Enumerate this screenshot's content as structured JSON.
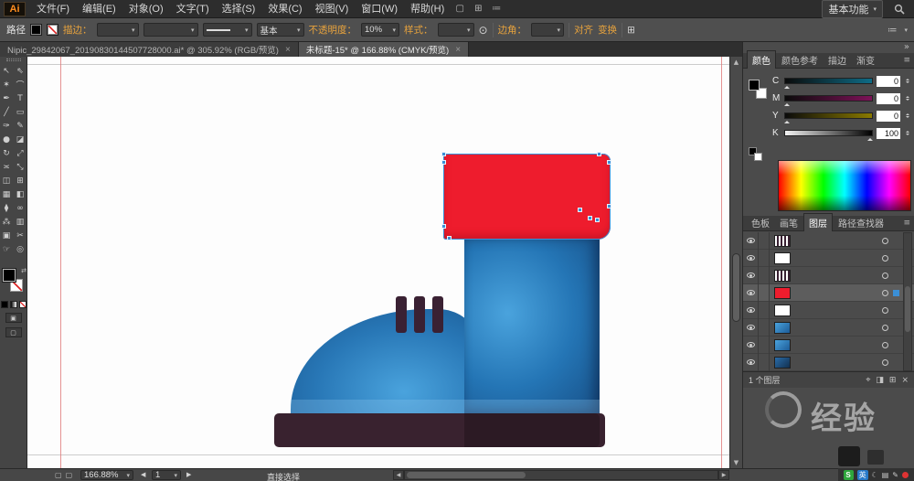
{
  "colors": {
    "red": "#ee1c2d",
    "blue_light": "#4aa3dd",
    "blue_mid": "#2475b5",
    "blue_dark": "#174e85",
    "plum": "#3a2133",
    "base_dark": "#39222f",
    "accent_orange": "#e8a33d",
    "select_blue": "#3b8fd6"
  },
  "icons": {
    "caret_down": "▾",
    "panel_menu": "≡",
    "collapse_right": "»",
    "scroll_up": "▲",
    "scroll_down": "▼",
    "scroll_left": "◀",
    "scroll_right": "▶",
    "doc_new": "▢",
    "grid": "⊞",
    "rows": "≔",
    "recolor": "⊙",
    "swap": "⇄",
    "moon": "☾",
    "pencil": "✎",
    "keyboard": "▤",
    "target_new": "⌖",
    "clip": "◨",
    "new_layer": "⊞",
    "delete": "⨯",
    "draw_mode": "▣",
    "screen_mode": "▢",
    "page_a": "▢",
    "page_b": "▢"
  },
  "menubar": {
    "logo": "Ai",
    "items": [
      {
        "label": "文件(F)"
      },
      {
        "label": "编辑(E)"
      },
      {
        "label": "对象(O)"
      },
      {
        "label": "文字(T)"
      },
      {
        "label": "选择(S)"
      },
      {
        "label": "效果(C)"
      },
      {
        "label": "视图(V)"
      },
      {
        "label": "窗口(W)"
      },
      {
        "label": "帮助(H)"
      }
    ],
    "workspace": "基本功能"
  },
  "controlbar": {
    "path_label": "路径",
    "stroke_label": "描边：",
    "basic_label": "基本",
    "opacity_label": "不透明度：",
    "opacity_value": "10%",
    "style_label": "样式：",
    "corner_label": "边角：",
    "align_label": "对齐",
    "transform_label": "变换"
  },
  "tabs": [
    {
      "title": "Nipic_29842067_20190830144507728000.ai* @ 305.92% (RGB/预览)",
      "close": "×"
    },
    {
      "title": "未标题-15* @ 166.88% (CMYK/预览)",
      "close": "×"
    }
  ],
  "toolbar": {
    "tools": [
      {
        "name": "selection-tool",
        "glyph": "↖"
      },
      {
        "name": "direct-selection-tool",
        "glyph": "⇖"
      },
      {
        "name": "magic-wand-tool",
        "glyph": "✶"
      },
      {
        "name": "lasso-tool",
        "glyph": "⌒"
      },
      {
        "name": "pen-tool",
        "glyph": "✒"
      },
      {
        "name": "type-tool",
        "glyph": "T"
      },
      {
        "name": "line-segment-tool",
        "glyph": "╱"
      },
      {
        "name": "rectangle-tool",
        "glyph": "▭"
      },
      {
        "name": "paintbrush-tool",
        "glyph": "✑"
      },
      {
        "name": "pencil-tool",
        "glyph": "✎"
      },
      {
        "name": "blob-brush-tool",
        "glyph": "●"
      },
      {
        "name": "eraser-tool",
        "glyph": "◪"
      },
      {
        "name": "rotate-tool",
        "glyph": "↻"
      },
      {
        "name": "scale-tool",
        "glyph": "⤢"
      },
      {
        "name": "width-tool",
        "glyph": "≍"
      },
      {
        "name": "free-transform-tool",
        "glyph": "⤡"
      },
      {
        "name": "shape-builder-tool",
        "glyph": "◫"
      },
      {
        "name": "perspective-grid-tool",
        "glyph": "⊞"
      },
      {
        "name": "mesh-tool",
        "glyph": "▦"
      },
      {
        "name": "gradient-tool",
        "glyph": "◧"
      },
      {
        "name": "eyedropper-tool",
        "glyph": "⧫"
      },
      {
        "name": "blend-tool",
        "glyph": "∞"
      },
      {
        "name": "symbol-sprayer-tool",
        "glyph": "⁂"
      },
      {
        "name": "column-graph-tool",
        "glyph": "▥"
      },
      {
        "name": "artboard-tool",
        "glyph": "▣"
      },
      {
        "name": "slice-tool",
        "glyph": "✂"
      },
      {
        "name": "hand-tool",
        "glyph": "☞"
      },
      {
        "name": "zoom-tool",
        "glyph": "◎"
      }
    ]
  },
  "panels": {
    "color": {
      "tabs": [
        {
          "label": "颜色",
          "state": "active"
        },
        {
          "label": "颜色参考",
          "state": ""
        },
        {
          "label": "描边",
          "state": ""
        },
        {
          "label": "渐变",
          "state": ""
        }
      ],
      "channels": [
        {
          "label": "C",
          "value": "0",
          "track": "track-c",
          "marker": "m-left"
        },
        {
          "label": "M",
          "value": "0",
          "track": "track-m",
          "marker": "m-left"
        },
        {
          "label": "Y",
          "value": "0",
          "track": "track-y",
          "marker": "m-left"
        },
        {
          "label": "K",
          "value": "100",
          "track": "track-k",
          "marker": "m-right"
        }
      ]
    },
    "dock_tabs": [
      {
        "label": "色板",
        "state": ""
      },
      {
        "label": "画笔",
        "state": ""
      },
      {
        "label": "图层",
        "state": "active"
      },
      {
        "label": "路径查找器",
        "state": ""
      }
    ],
    "layers": {
      "rows": [
        {
          "thumb": "thumb-bars",
          "sel": ""
        },
        {
          "thumb": "thumb-blank",
          "sel": ""
        },
        {
          "thumb": "thumb-bars",
          "sel": ""
        },
        {
          "thumb": "thumb-red",
          "sel": "selected"
        },
        {
          "thumb": "thumb-blank",
          "sel": ""
        },
        {
          "thumb": "thumb-blue",
          "sel": ""
        },
        {
          "thumb": "thumb-blue",
          "sel": ""
        },
        {
          "thumb": "thumb-navy",
          "sel": ""
        }
      ],
      "footer": "1 个图层"
    }
  },
  "statusbar": {
    "zoom": "166.88%",
    "artboard": "1",
    "tool": "直接选择"
  },
  "watermark": {
    "text": "经验"
  },
  "ime": {
    "sogou": "S",
    "lang": "英"
  }
}
